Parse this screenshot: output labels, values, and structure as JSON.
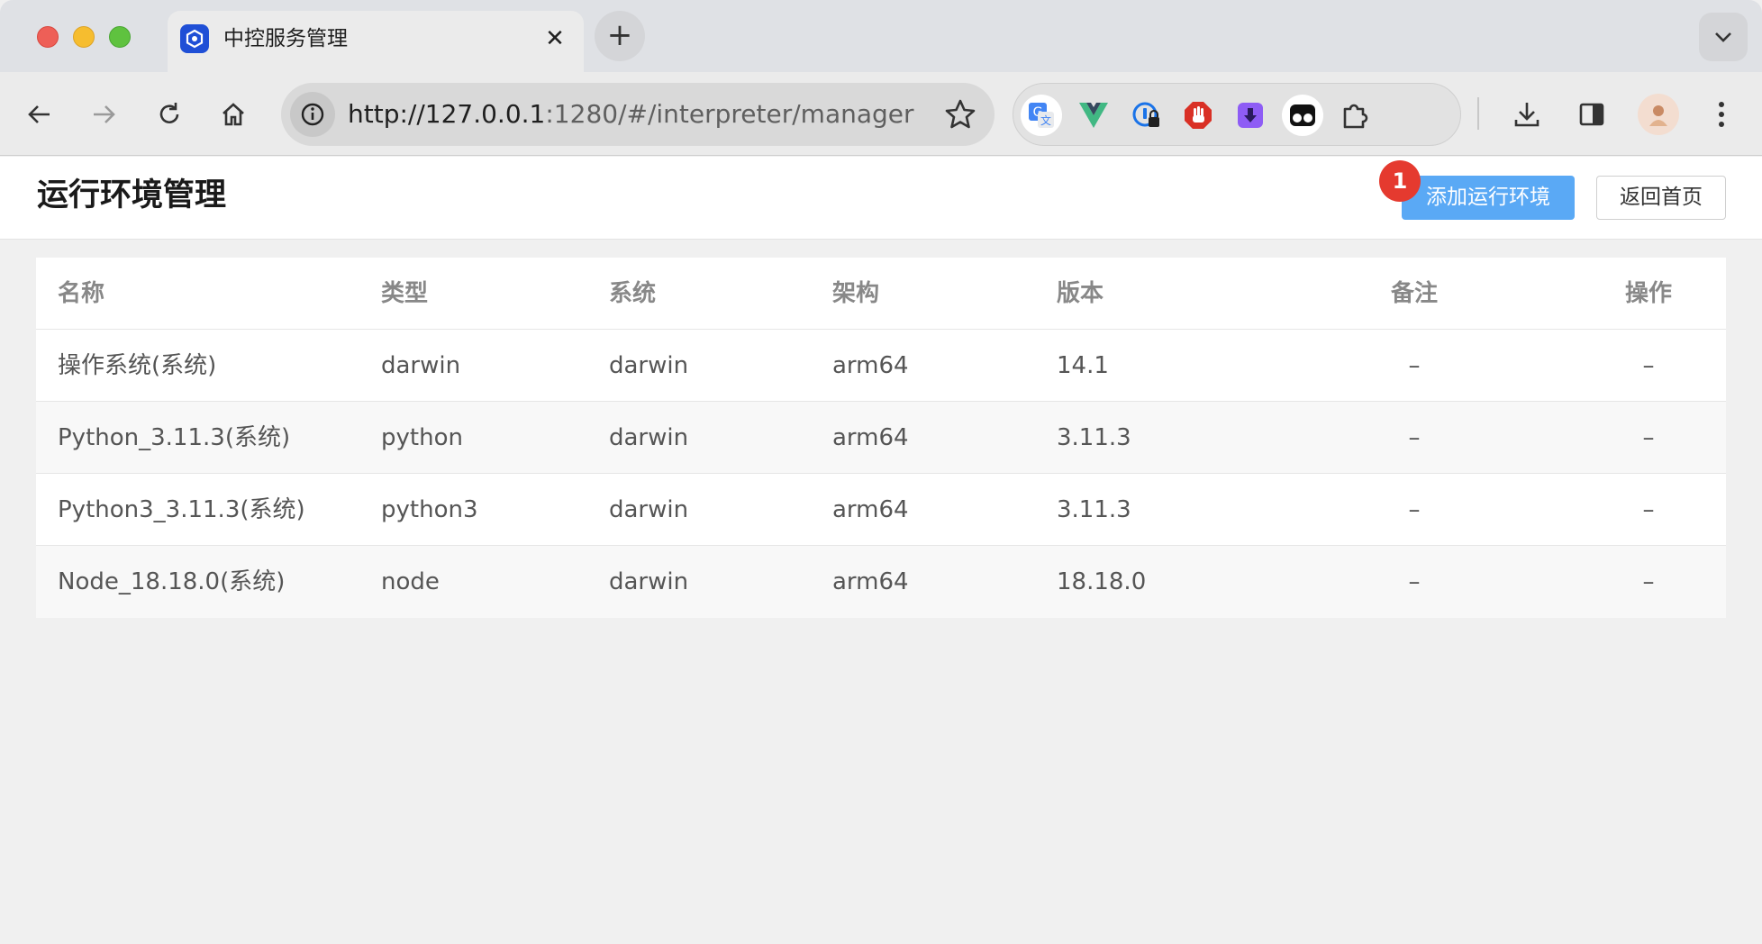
{
  "browser": {
    "tab_title": "中控服务管理",
    "tab_close": "✕",
    "new_tab": "+",
    "url_host": "http://127.0.0.1",
    "url_rest": ":1280/#/interpreter/manager"
  },
  "header": {
    "title": "运行环境管理",
    "add_button": "添加运行环境",
    "badge": "1",
    "back_button": "返回首页"
  },
  "table": {
    "columns": [
      "名称",
      "类型",
      "系统",
      "架构",
      "版本",
      "备注",
      "操作"
    ],
    "rows": [
      {
        "name": "操作系统(系统)",
        "type": "darwin",
        "system": "darwin",
        "arch": "arm64",
        "version": "14.1",
        "remark": "–",
        "action": "–"
      },
      {
        "name": "Python_3.11.3(系统)",
        "type": "python",
        "system": "darwin",
        "arch": "arm64",
        "version": "3.11.3",
        "remark": "–",
        "action": "–"
      },
      {
        "name": "Python3_3.11.3(系统)",
        "type": "python3",
        "system": "darwin",
        "arch": "arm64",
        "version": "3.11.3",
        "remark": "–",
        "action": "–"
      },
      {
        "name": "Node_18.18.0(系统)",
        "type": "node",
        "system": "darwin",
        "arch": "arm64",
        "version": "18.18.0",
        "remark": "–",
        "action": "–"
      }
    ]
  }
}
